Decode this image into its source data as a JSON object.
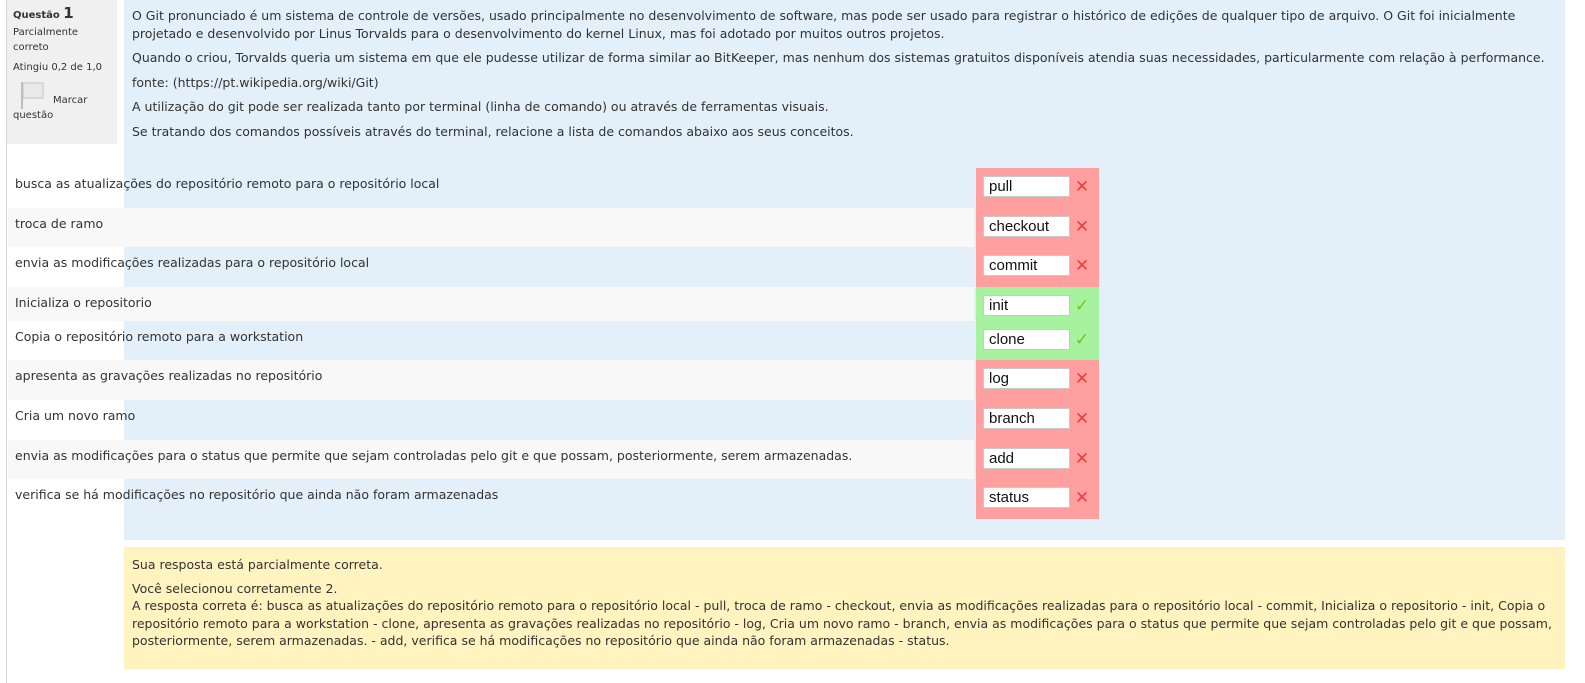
{
  "info": {
    "question_label": "Questão",
    "question_number": "1",
    "state": "Parcialmente correto",
    "grade": "Atingiu 0,2 de 1,0",
    "flag_label_1": "Marcar",
    "flag_label_2": "questão"
  },
  "question": {
    "paragraphs": [
      "O Git pronunciado é um sistema de controle de versões, usado principalmente no desenvolvimento de software, mas pode ser usado para registrar o histórico de edições de qualquer tipo de arquivo. O Git foi inicialmente projetado e desenvolvido por Linus Torvalds para o desenvolvimento do kernel Linux, mas foi adotado por muitos outros projetos.",
      "Quando o criou, Torvalds queria um sistema em que ele pudesse utilizar de forma similar ao BitKeeper, mas nenhum dos sistemas gratuitos disponíveis atendia suas necessidades, particularmente com relação à performance.",
      "fonte: (https://pt.wikipedia.org/wiki/Git)",
      "A utilização do git  pode ser realizada tanto por terminal (linha de comando) ou através de ferramentas visuais.",
      "Se tratando dos comandos possíveis através do terminal, relacione a lista de comandos abaixo aos seus conceitos."
    ]
  },
  "matches": [
    {
      "concept": "busca as atualizações do repositório remoto para o repositório local",
      "answer": "pull",
      "correct": false
    },
    {
      "concept": "troca de ramo",
      "answer": "checkout",
      "correct": false
    },
    {
      "concept": "envia as modificações realizadas para o repositório local",
      "answer": "commit",
      "correct": false
    },
    {
      "concept": "Inicializa o repositorio",
      "answer": "init",
      "correct": true
    },
    {
      "concept": "Copia o repositório remoto para a workstation",
      "answer": "clone",
      "correct": true
    },
    {
      "concept": "apresenta as gravações realizadas no repositório",
      "answer": "log",
      "correct": false
    },
    {
      "concept": "Cria um novo ramo",
      "answer": "branch",
      "correct": false
    },
    {
      "concept": "envia as modificações para o status que permite que sejam controladas pelo git e que possam, posteriormente, serem armazenadas.",
      "answer": "add",
      "correct": false
    },
    {
      "concept": "verifica se há modificações no repositório que ainda não foram armazenadas",
      "answer": "status",
      "correct": false
    }
  ],
  "marks": {
    "wrong": "✕",
    "right": "✓"
  },
  "colors": {
    "wrong_bg": "#ff9f9f",
    "right_bg": "#a7f29e",
    "wrong_mark": "#ee3b3b",
    "right_mark": "#80c01e",
    "feedback_bg": "#fff3bf"
  },
  "feedback": {
    "summary": "Sua resposta está parcialmente correta.",
    "selected": "Você selecionou corretamente 2.",
    "correct_answer": "A resposta correta é: busca as atualizações do repositório remoto para o repositório local - pull, troca de ramo - checkout, envia as modificações realizadas para o repositório local - commit, Inicializa o repositorio - init, Copia o repositório remoto para a workstation - clone, apresenta as gravações realizadas no repositório - log, Cria um novo ramo  - branch, envia as modificações para o status que permite que sejam controladas pelo git e que possam, posteriormente, serem armazenadas. - add, verifica se há modificações no repositório que ainda não foram armazenadas - status."
  }
}
